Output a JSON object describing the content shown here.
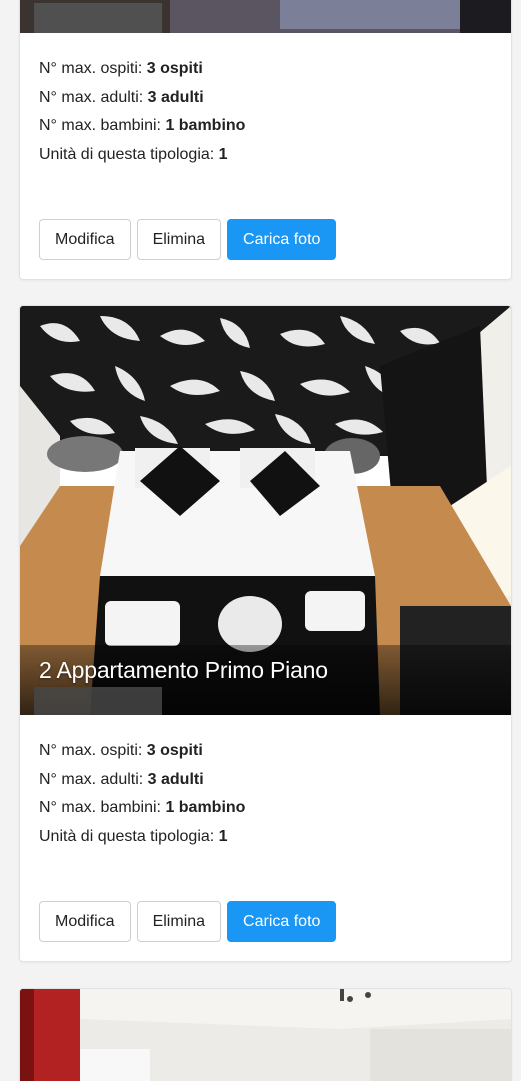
{
  "cards": [
    {
      "title": "",
      "labels": {
        "guests": "N° max. ospiti: ",
        "adults": "N° max. adulti: ",
        "children": "N° max. bambini: ",
        "units": "Unità di questa tipologia: "
      },
      "values": {
        "guests": "3 ospiti",
        "adults": "3 adulti",
        "children": "1 bambino",
        "units": "1"
      },
      "buttons": {
        "edit": "Modifica",
        "delete": "Elimina",
        "upload": "Carica foto"
      }
    },
    {
      "title": "2 Appartamento Primo Piano",
      "labels": {
        "guests": "N° max. ospiti: ",
        "adults": "N° max. adulti: ",
        "children": "N° max. bambini: ",
        "units": "Unità di questa tipologia: "
      },
      "values": {
        "guests": "3 ospiti",
        "adults": "3 adulti",
        "children": "1 bambino",
        "units": "1"
      },
      "buttons": {
        "edit": "Modifica",
        "delete": "Elimina",
        "upload": "Carica foto"
      }
    }
  ],
  "colors": {
    "primary": "#1a96f5",
    "page_bg": "#f3f3f3",
    "card_border": "#e2e2e2"
  }
}
